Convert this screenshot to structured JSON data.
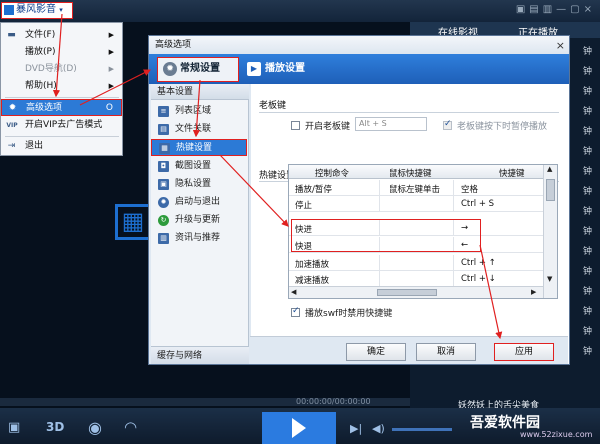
{
  "player": {
    "logo_label": "暴风影音",
    "right_tabs": {
      "online": "在线影视",
      "playing": "正在播放"
    },
    "right_items": [
      "钟",
      "钟",
      "钟",
      "钟",
      "钟",
      "钟",
      "钟",
      "钟",
      "钟",
      "钟",
      "钟",
      "钟",
      "钟",
      "钟",
      "钟",
      "钟"
    ],
    "timecode": "00:00:00/00:00:00",
    "now_playing": "妖然妖上的舌尖美食",
    "control_3d": "3D",
    "watermark": {
      "main": "吾爱软件园",
      "sub": "www.52zixue.com"
    }
  },
  "menu": {
    "items": [
      {
        "label": "文件(F)",
        "submenu": true
      },
      {
        "label": "播放(P)",
        "submenu": true
      },
      {
        "label": "DVD导航(D)",
        "submenu": true,
        "disabled": true
      },
      {
        "label": "帮助(H)",
        "submenu": true
      },
      {
        "label": "高级选项",
        "shortcut": "O",
        "selected": true
      },
      {
        "label": "开启VIP去广告模式",
        "icon_text": "VIP"
      },
      {
        "label": "退出"
      }
    ]
  },
  "dialog": {
    "title": "高级选项",
    "close": "×",
    "tabs": {
      "general": "常规设置",
      "play": "播放设置"
    },
    "sidebar_header": "基本设置",
    "sidebar_items": [
      "列表区域",
      "文件关联",
      "热键设置",
      "截图设置",
      "隐私设置",
      "启动与退出",
      "升级与更新",
      "资讯与推荐"
    ],
    "sidebar_footer": "缓存与网络",
    "boss_key": {
      "section": "老板键",
      "enable_label": "开启老板键",
      "field_value": "Alt + S",
      "pause_label": "老板键按下时暂停播放"
    },
    "hotkeys": {
      "section": "热键设置",
      "columns": [
        "控制命令",
        "鼠标快捷键",
        "快捷键"
      ],
      "rows": [
        [
          "播放/暂停",
          "鼠标左键单击",
          "空格"
        ],
        [
          "停止",
          "",
          "Ctrl + S"
        ],
        [
          "快进",
          "",
          "→"
        ],
        [
          "快退",
          "",
          "←"
        ],
        [
          "加速播放",
          "",
          "Ctrl + ↑"
        ],
        [
          "减速播放",
          "",
          "Ctrl + ↓"
        ]
      ],
      "disable_sw_label": "播放swf时禁用快捷键"
    },
    "buttons": {
      "ok": "确定",
      "cancel": "取消",
      "apply": "应用"
    }
  }
}
